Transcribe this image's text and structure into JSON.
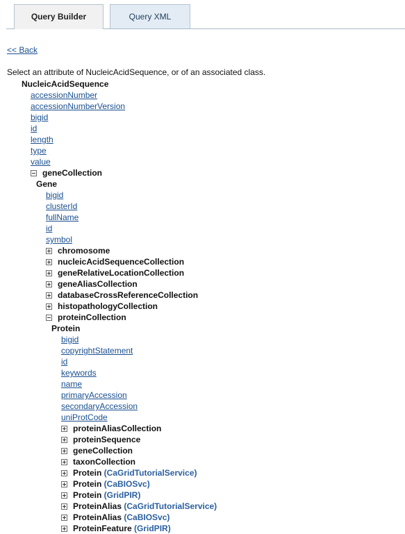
{
  "tabs": {
    "query_builder": "Query Builder",
    "query_xml": "Query XML"
  },
  "back_link": "<< Back",
  "instruction": "Select an attribute of NucleicAcidSequence, or of an associated class.",
  "root": {
    "class_name": "NucleicAcidSequence",
    "attributes": [
      "accessionNumber",
      "accessionNumberVersion",
      "bigid",
      "id",
      "length",
      "type",
      "value"
    ],
    "expanded_association": "geneCollection"
  },
  "gene": {
    "class_name": "Gene",
    "attributes": [
      "bigid",
      "clusterId",
      "fullName",
      "id",
      "symbol"
    ],
    "associations": [
      "chromosome",
      "nucleicAcidSequenceCollection",
      "geneRelativeLocationCollection",
      "geneAliasCollection",
      "databaseCrossReferenceCollection",
      "histopathologyCollection"
    ],
    "expanded_association": "proteinCollection"
  },
  "protein": {
    "class_name": "Protein",
    "attributes": [
      "bigid",
      "copyrightStatement",
      "id",
      "keywords",
      "name",
      "primaryAccession",
      "secondaryAccession",
      "uniProtCode"
    ],
    "associations": [
      {
        "name": "proteinAliasCollection",
        "service": ""
      },
      {
        "name": "proteinSequence",
        "service": ""
      },
      {
        "name": "geneCollection",
        "service": ""
      },
      {
        "name": "taxonCollection",
        "service": ""
      },
      {
        "name": "Protein",
        "service": "(CaGridTutorialService)"
      },
      {
        "name": "Protein",
        "service": "(CaBIOSvc)"
      },
      {
        "name": "Protein",
        "service": "(GridPIR)"
      },
      {
        "name": "ProteinAlias",
        "service": "(CaGridTutorialService)"
      },
      {
        "name": "ProteinAlias",
        "service": "(CaBIOSvc)"
      },
      {
        "name": "ProteinFeature",
        "service": "(GridPIR)"
      }
    ]
  },
  "colors": {
    "link": "#1a4f8f",
    "service_label": "#2b5f9e",
    "tab_active_bg": "#f1f1f1",
    "tab_inactive_bg": "#e3ecf4"
  }
}
